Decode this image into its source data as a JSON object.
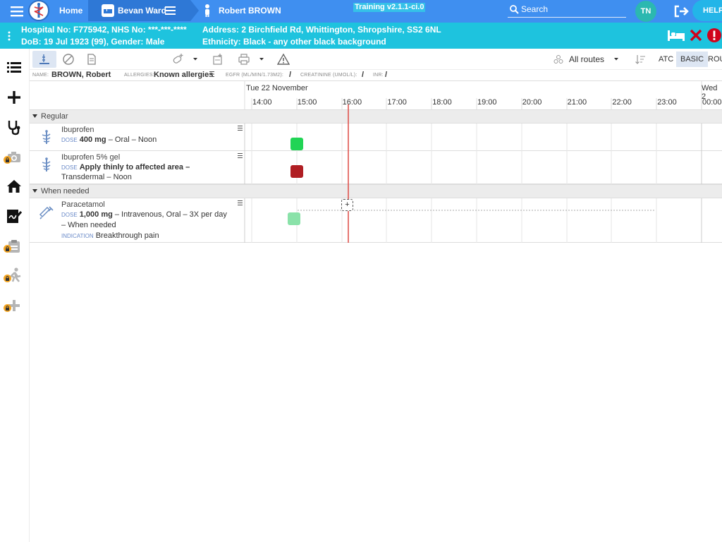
{
  "nav": {
    "home": "Home",
    "ward": "Bevan Ward",
    "patient": "Robert BROWN",
    "training": "Training v2.1.1-ci.0",
    "search_placeholder": "Search",
    "avatar": "TN",
    "help": "HELP",
    "accent": "#3f8ff0"
  },
  "banner": {
    "line1_left": "Hospital No: F775942, NHS No: ***-***-****",
    "line2_left": "DoB: 19 Jul 1923 (99), Gender: Male",
    "line1_right": "Address: 2 Birchfield Rd, Whittington, Shropshire, SS2 6NL",
    "line2_right": "Ethnicity: Black - any other black background",
    "color": "#1ec3de"
  },
  "toolbar": {
    "routes": "All routes",
    "atc": "ATC",
    "basic": "BASIC",
    "route": "ROU"
  },
  "info": {
    "name_label": "NAME:",
    "name": "BROWN, Robert",
    "allergies_label": "ALLERGIES:",
    "allergies": "Known allergies",
    "egfr_label": "EGFR (ML/MIN/1.73M2):",
    "egfr": "/",
    "creat_label": "CREATININE (UMOL/L):",
    "creat": "/",
    "inr_label": "INR:",
    "inr": "/"
  },
  "chart": {
    "date1": "Tue 22 November",
    "date2": "Wed 2",
    "hours": [
      "14:00",
      "15:00",
      "16:00",
      "17:00",
      "18:00",
      "19:00",
      "20:00",
      "21:00",
      "22:00",
      "23:00",
      "00:00"
    ],
    "groups": {
      "regular": "Regular",
      "prn": "When needed"
    },
    "drugs": [
      {
        "name": "Ibuprofen",
        "dose_label": "DOSE",
        "dose": "400 mg",
        "detail": " – Oral – Noon",
        "status_color": "#21d455"
      },
      {
        "name": "Ibuprofen 5% gel",
        "dose_label": "DOSE",
        "dose": "Apply thinly to affected area –",
        "detail2": "Transdermal – Noon",
        "status_color": "#b01e23"
      },
      {
        "name": "Paracetamol",
        "dose_label": "DOSE",
        "dose": "1,000 mg",
        "detail": " – Intravenous, Oral – 3X per day",
        "detail2": "– When needed",
        "indication_label": "INDICATION",
        "indication": "Breakthrough pain",
        "status_color": "#8ae2a9"
      }
    ],
    "add_symbol": "+",
    "now_color": "#e0534e"
  }
}
